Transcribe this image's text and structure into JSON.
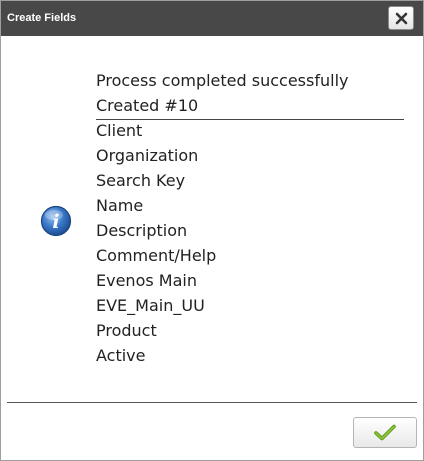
{
  "window": {
    "title": "Create Fields"
  },
  "icons": {
    "close": "close-icon",
    "info": "info-icon",
    "ok": "checkmark-icon"
  },
  "message": {
    "status": "Process completed successfully",
    "created": "Created #10",
    "fields": [
      "Client",
      "Organization",
      "Search Key",
      "Name",
      "Description",
      "Comment/Help",
      "Evenos Main",
      "EVE_Main_UU",
      "Product",
      "Active"
    ]
  },
  "colors": {
    "titlebar": "#484848",
    "info_blue": "#2f6fc0",
    "check_green": "#6aa61c"
  }
}
